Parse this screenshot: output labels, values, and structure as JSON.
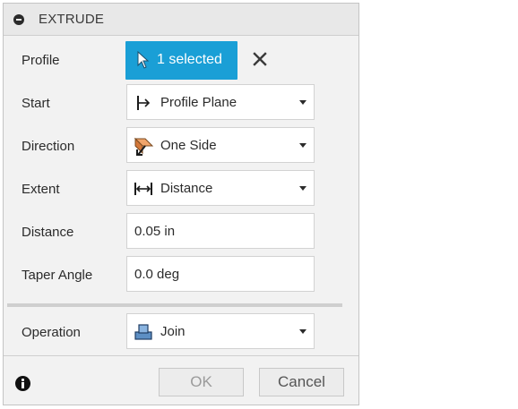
{
  "header": {
    "title": "EXTRUDE",
    "icon": "collapse-icon"
  },
  "rows": {
    "profile": {
      "label": "Profile",
      "button_label": "1 selected",
      "accent": "#1a9fd6"
    },
    "start": {
      "label": "Start",
      "value": "Profile Plane"
    },
    "direction": {
      "label": "Direction",
      "value": "One Side"
    },
    "extent": {
      "label": "Extent",
      "value": "Distance"
    },
    "distance": {
      "label": "Distance",
      "value": "0.05 in"
    },
    "taper": {
      "label": "Taper Angle",
      "value": "0.0 deg"
    },
    "operation": {
      "label": "Operation",
      "value": "Join"
    }
  },
  "footer": {
    "ok_label": "OK",
    "cancel_label": "Cancel"
  }
}
